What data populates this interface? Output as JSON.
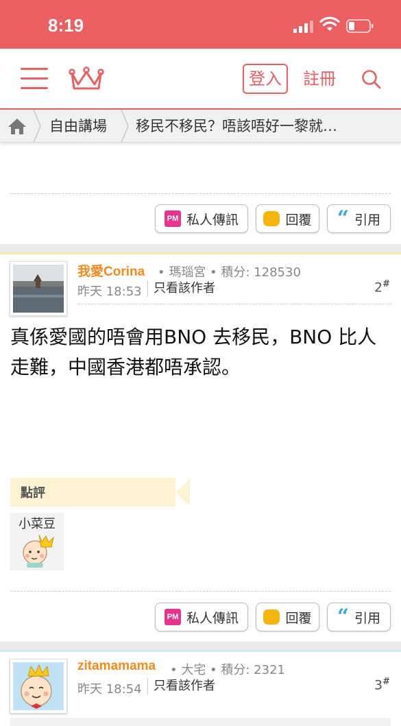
{
  "status_bar": {
    "time": "8:19"
  },
  "nav": {
    "login_label": "登入",
    "register_label": "註冊"
  },
  "breadcrumb": {
    "items": [
      {
        "label": "自由講場"
      },
      {
        "label": "移民不移民？唔該唔好一黎就…"
      }
    ]
  },
  "actions": {
    "pm_label": "私人傳訊",
    "reply_label": "回覆",
    "quote_label": "引用",
    "pm_icon_text": "PM"
  },
  "posts": [
    {
      "username": "我愛Corina",
      "meta": "• 瑪瑙宮 • 積分: 128530",
      "time": "昨天 18:53",
      "author_only": "只看該作者",
      "floor": "2",
      "floor_mark": "#",
      "content": "真係愛國的唔會用BNO 去移民，BNO 比人走難，中國香港都唔承認。",
      "comment_section_label": "點評",
      "commenters": [
        {
          "name": "小菜豆"
        }
      ]
    },
    {
      "username": "zitamamama",
      "meta": "• 大宅 • 積分: 2321",
      "time": "昨天 18:54",
      "author_only": "只看該作者",
      "floor": "3",
      "floor_mark": "#"
    }
  ],
  "colors": {
    "brand": "#ea5f62",
    "username": "#f28a1e",
    "pm": "#e6358e",
    "reply": "#f6b40e",
    "quote": "#3ba7e0"
  }
}
